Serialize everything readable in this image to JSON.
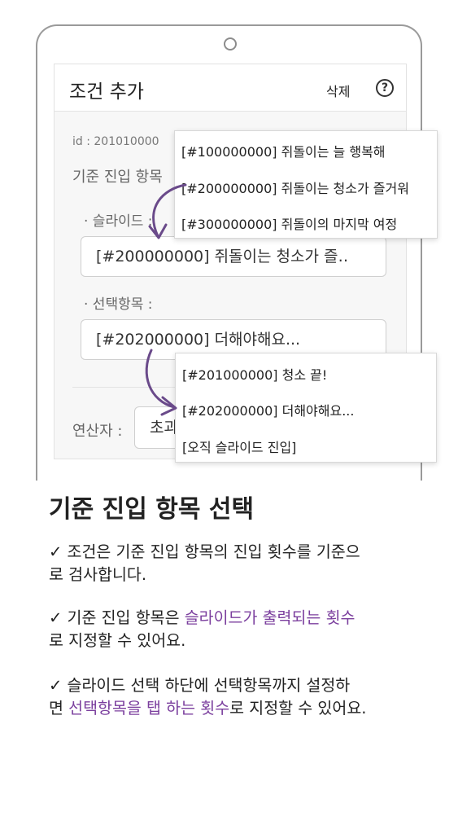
{
  "modal": {
    "title": "조건 추가",
    "delete_label": "삭제",
    "help_icon": "?",
    "id_text": "id : 201010000",
    "base_label": "기준 진입 항목",
    "slide_label": "· 슬라이드 :",
    "slide_value": "[#200000000] 쥐돌이는 청소가 즐‥",
    "choice_label": "· 선택항목 :",
    "choice_value": "[#202000000] 더해야해요...",
    "operator_label": "연산자 :",
    "operator_value": "초과"
  },
  "slide_dropdown": {
    "items": [
      "[#100000000] 쥐돌이는 늘 행복해",
      "[#200000000] 쥐돌이는 청소가 즐거워",
      "[#300000000] 쥐돌이의 마지막 여정"
    ]
  },
  "choice_dropdown": {
    "items": [
      "[#201000000] 청소 끝!",
      "[#202000000] 더해야해요...",
      "[오직 슬라이드 진입]"
    ]
  },
  "content": {
    "title": "기준 진입 항목 선택",
    "b1_line1": "✓ 조건은 기준 진입 항목의 진입 횟수를 기준으",
    "b1_line2": "로 검사합니다.",
    "b2_pre": "✓ 기준 진입 항목은 ",
    "b2_hl": "슬라이드가 출력되는 횟수",
    "b2_line2": "로 지정할 수 있어요.",
    "b3_line1": "✓ 슬라이드 선택 하단에 선택항목까지 설정하",
    "b3_pre": "면 ",
    "b3_hl": "선택항목을 탭 하는 횟수",
    "b3_post": "로 지정할 수 있어요."
  },
  "colors": {
    "accent_purple": "#7b3f9e",
    "arrow": "#6a4a8a"
  }
}
